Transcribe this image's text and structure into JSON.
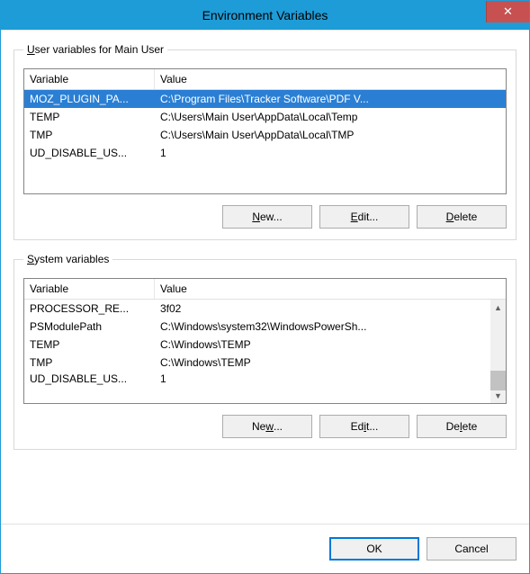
{
  "window": {
    "title": "Environment Variables",
    "close_glyph": "✕"
  },
  "user_group": {
    "legend_pre": "U",
    "legend_post": "ser variables for Main User",
    "headers": {
      "variable": "Variable",
      "value": "Value"
    },
    "rows": [
      {
        "variable": "MOZ_PLUGIN_PA...",
        "value": "C:\\Program Files\\Tracker Software\\PDF V...",
        "selected": true
      },
      {
        "variable": "TEMP",
        "value": "C:\\Users\\Main User\\AppData\\Local\\Temp"
      },
      {
        "variable": "TMP",
        "value": "C:\\Users\\Main User\\AppData\\Local\\TMP"
      },
      {
        "variable": "UD_DISABLE_US...",
        "value": "1"
      }
    ],
    "buttons": {
      "new_pre": "N",
      "new_post": "ew...",
      "edit_pre": "E",
      "edit_post": "dit...",
      "delete_pre": "D",
      "delete_post": "elete"
    }
  },
  "system_group": {
    "legend_pre": "S",
    "legend_post": "ystem variables",
    "headers": {
      "variable": "Variable",
      "value": "Value"
    },
    "rows": [
      {
        "variable": "PROCESSOR_RE...",
        "value": "3f02"
      },
      {
        "variable": "PSModulePath",
        "value": "C:\\Windows\\system32\\WindowsPowerSh..."
      },
      {
        "variable": "TEMP",
        "value": "C:\\Windows\\TEMP"
      },
      {
        "variable": "TMP",
        "value": "C:\\Windows\\TEMP"
      },
      {
        "variable": "UD_DISABLE_US...",
        "value": "1"
      }
    ],
    "scroll": {
      "up": "▲",
      "down": "▼"
    },
    "buttons": {
      "new_pre": "Ne",
      "new_post": "...",
      "new_und": "w",
      "edit_pre": "Ed",
      "edit_post": "t...",
      "edit_und": "i",
      "delete_pre": "De",
      "delete_post": "ete",
      "delete_und": "l"
    }
  },
  "footer": {
    "ok": "OK",
    "cancel": "Cancel"
  }
}
